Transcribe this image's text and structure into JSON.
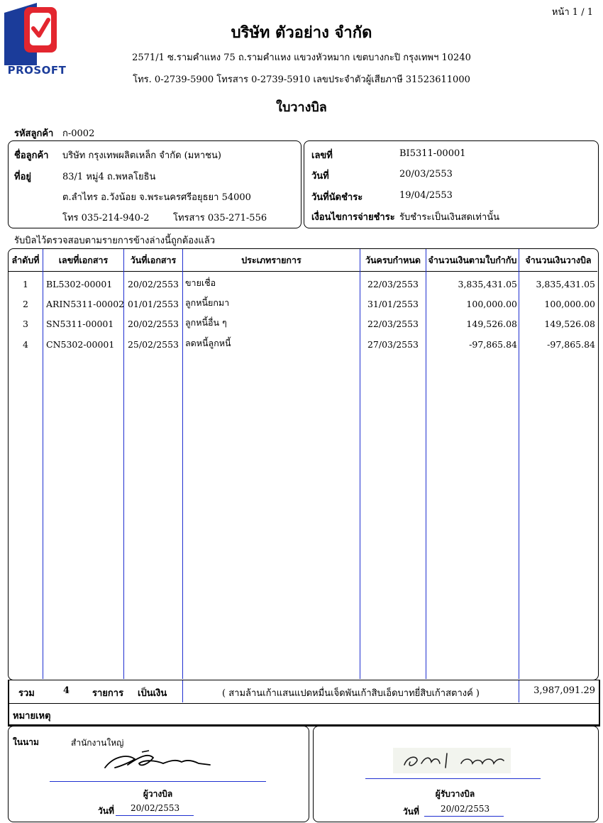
{
  "page_no": "หน้า 1 / 1",
  "logo_text": "PROSOFT",
  "company": {
    "name": "บริษัท ตัวอย่าง จำกัด",
    "address": "2571/1 ซ.รามคำแหง 75 ถ.รามคำแหง แขวงหัวหมาก เขตบางกะปิ กรุงเทพฯ 10240",
    "contact": "โทร. 0-2739-5900 โทรสาร 0-2739-5910 เลขประจำตัวผู้เสียภาษี 31523611000"
  },
  "doc_title": "ใบวางบิล",
  "customer": {
    "code_label": "รหัสลูกค้า",
    "code": "ก-0002",
    "name_label": "ชื่อลูกค้า",
    "name": "บริษัท กรุงเทพผลิตเหล็ก จำกัด (มหาชน)",
    "address_label": "ที่อยู่",
    "address1": "83/1 หมู่4 ถ.พหลโยธิน",
    "address2": "ต.ลำไทร อ.วังน้อย จ.พระนครศรีอยุธยา 54000",
    "phone": "โทร  035-214-940-2",
    "fax": "โทรสาร  035-271-556"
  },
  "doc_info": {
    "no_label": "เลขที่",
    "no": "BI5311-00001",
    "date_label": "วันที่",
    "date": "20/03/2553",
    "due_label": "วันที่นัดชำระ",
    "due": "19/04/2553",
    "terms_label": "เงื่อนไขการจ่ายชำระ",
    "terms": "รับชำระเป็นเงินสดเท่านั้น"
  },
  "received_note": "รับบิลไว้ตรวจสอบตามรายการข้างล่างนี้ถูกต้องแล้ว",
  "table": {
    "headers": [
      "ลำดับที่",
      "เลขที่เอกสาร",
      "วันที่เอกสาร",
      "ประเภทรายการ",
      "วันครบกำหนด",
      "จำนวนเงินตามใบกำกับ",
      "จำนวนเงินวางบิล"
    ],
    "rows": [
      [
        "1",
        "BL5302-00001",
        "20/02/2553",
        "ขายเชื่อ",
        "22/03/2553",
        "3,835,431.05",
        "3,835,431.05"
      ],
      [
        "2",
        "ARIN5311-00002",
        "01/01/2553",
        "ลูกหนี้ยกมา",
        "31/01/2553",
        "100,000.00",
        "100,000.00"
      ],
      [
        "3",
        "SN5311-00001",
        "20/02/2553",
        "ลูกหนี้อื่น ๆ",
        "22/03/2553",
        "149,526.08",
        "149,526.08"
      ],
      [
        "4",
        "CN5302-00001",
        "25/02/2553",
        "ลดหนี้ลูกหนี้",
        "27/03/2553",
        "-97,865.84",
        "-97,865.84"
      ]
    ]
  },
  "totals": {
    "total_label": "รวม",
    "count": "4",
    "items_label": "รายการ",
    "amount_label": "เป็นเงิน",
    "amount_text": "( สามล้านเก้าแสนแปดหมื่นเจ็ดพันเก้าสิบเอ็ดบาทยี่สิบเก้าสตางค์ )",
    "amount": "3,987,091.29"
  },
  "remark_label": "หมายเหตุ",
  "sign_left": {
    "on_behalf_label": "ในนาม",
    "on_behalf": "สำนักงานใหญ่",
    "role": "ผู้วางบิล",
    "date_label": "วันที่",
    "date": "20/02/2553"
  },
  "sign_right": {
    "role": "ผู้รับวางบิล",
    "date_label": "วันที่",
    "date": "20/02/2553"
  },
  "colors": {
    "rule_blue": "#1f2fd0",
    "logo_red": "#e3262f",
    "logo_blue": "#1b3c9a"
  }
}
